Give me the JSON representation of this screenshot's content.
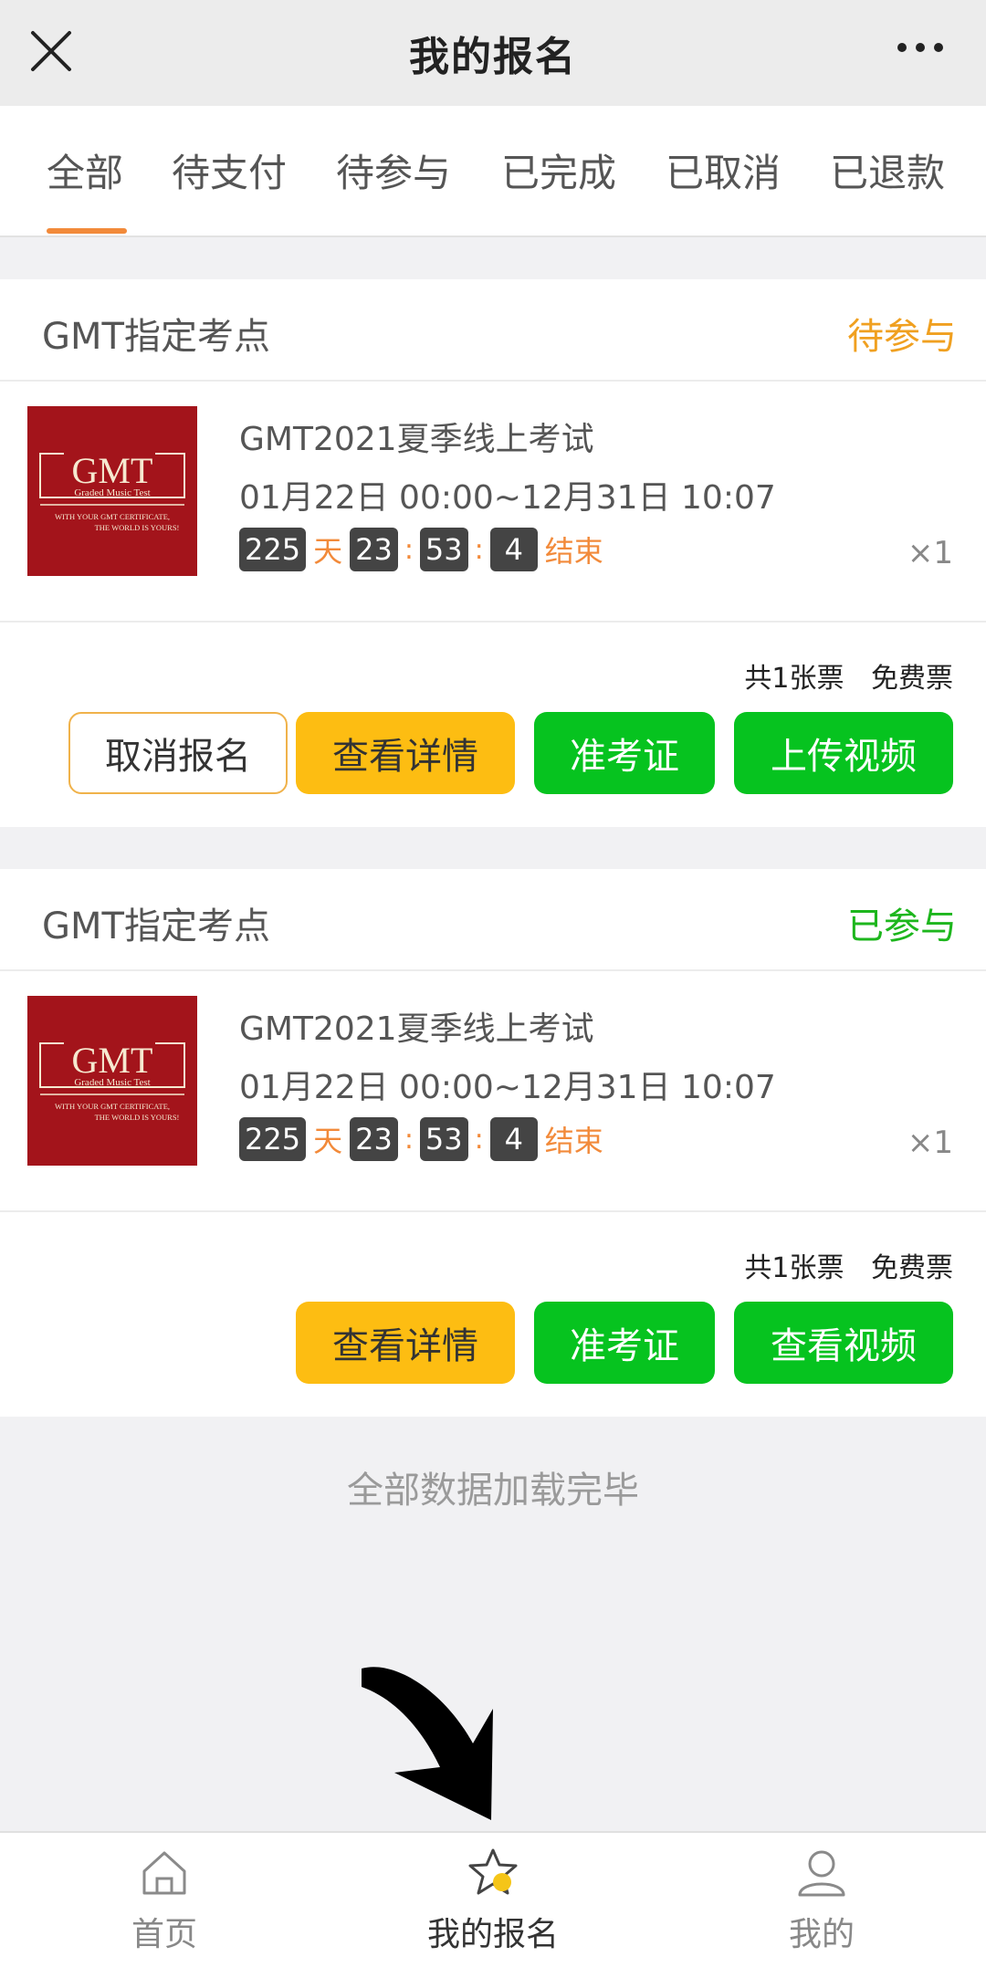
{
  "header": {
    "title": "我的报名"
  },
  "tabs": [
    {
      "label": "全部",
      "active": true
    },
    {
      "label": "待支付"
    },
    {
      "label": "待参与"
    },
    {
      "label": "已完成"
    },
    {
      "label": "已取消"
    },
    {
      "label": "已退款"
    }
  ],
  "orders": [
    {
      "shop": "GMT指定考点",
      "status": "待参与",
      "status_color": "#f0a020",
      "logo": {
        "brand": "GMT",
        "sub": "Graded Music Test",
        "tagline1": "WITH YOUR GMT CERTIFICATE,",
        "tagline2": "THE WORLD IS YOURS!"
      },
      "product": "GMT2021夏季线上考试",
      "time": "01月22日 00:00~12月31日 10:07",
      "countdown": {
        "days": "225",
        "day_unit": "天",
        "hours": "23",
        "minutes": "53",
        "seconds": "4",
        "end": "结束"
      },
      "qty": "×1",
      "tickets": "共1张票",
      "ticket_type": "免费票",
      "buttons": [
        "取消报名",
        "查看详情",
        "准考证",
        "上传视频"
      ]
    },
    {
      "shop": "GMT指定考点",
      "status": "已参与",
      "status_color": "#1db61d",
      "logo": {
        "brand": "GMT",
        "sub": "Graded Music Test",
        "tagline1": "WITH YOUR GMT CERTIFICATE,",
        "tagline2": "THE WORLD IS YOURS!"
      },
      "product": "GMT2021夏季线上考试",
      "time": "01月22日 00:00~12月31日 10:07",
      "countdown": {
        "days": "225",
        "day_unit": "天",
        "hours": "23",
        "minutes": "53",
        "seconds": "4",
        "end": "结束"
      },
      "qty": "×1",
      "tickets": "共1张票",
      "ticket_type": "免费票",
      "buttons": [
        "查看详情",
        "准考证",
        "查看视频"
      ]
    }
  ],
  "footer_text": "全部数据加载完毕",
  "bottom_nav": [
    {
      "label": "首页",
      "icon": "home-icon"
    },
    {
      "label": "我的报名",
      "icon": "star-icon",
      "active": true
    },
    {
      "label": "我的",
      "icon": "user-icon"
    }
  ]
}
